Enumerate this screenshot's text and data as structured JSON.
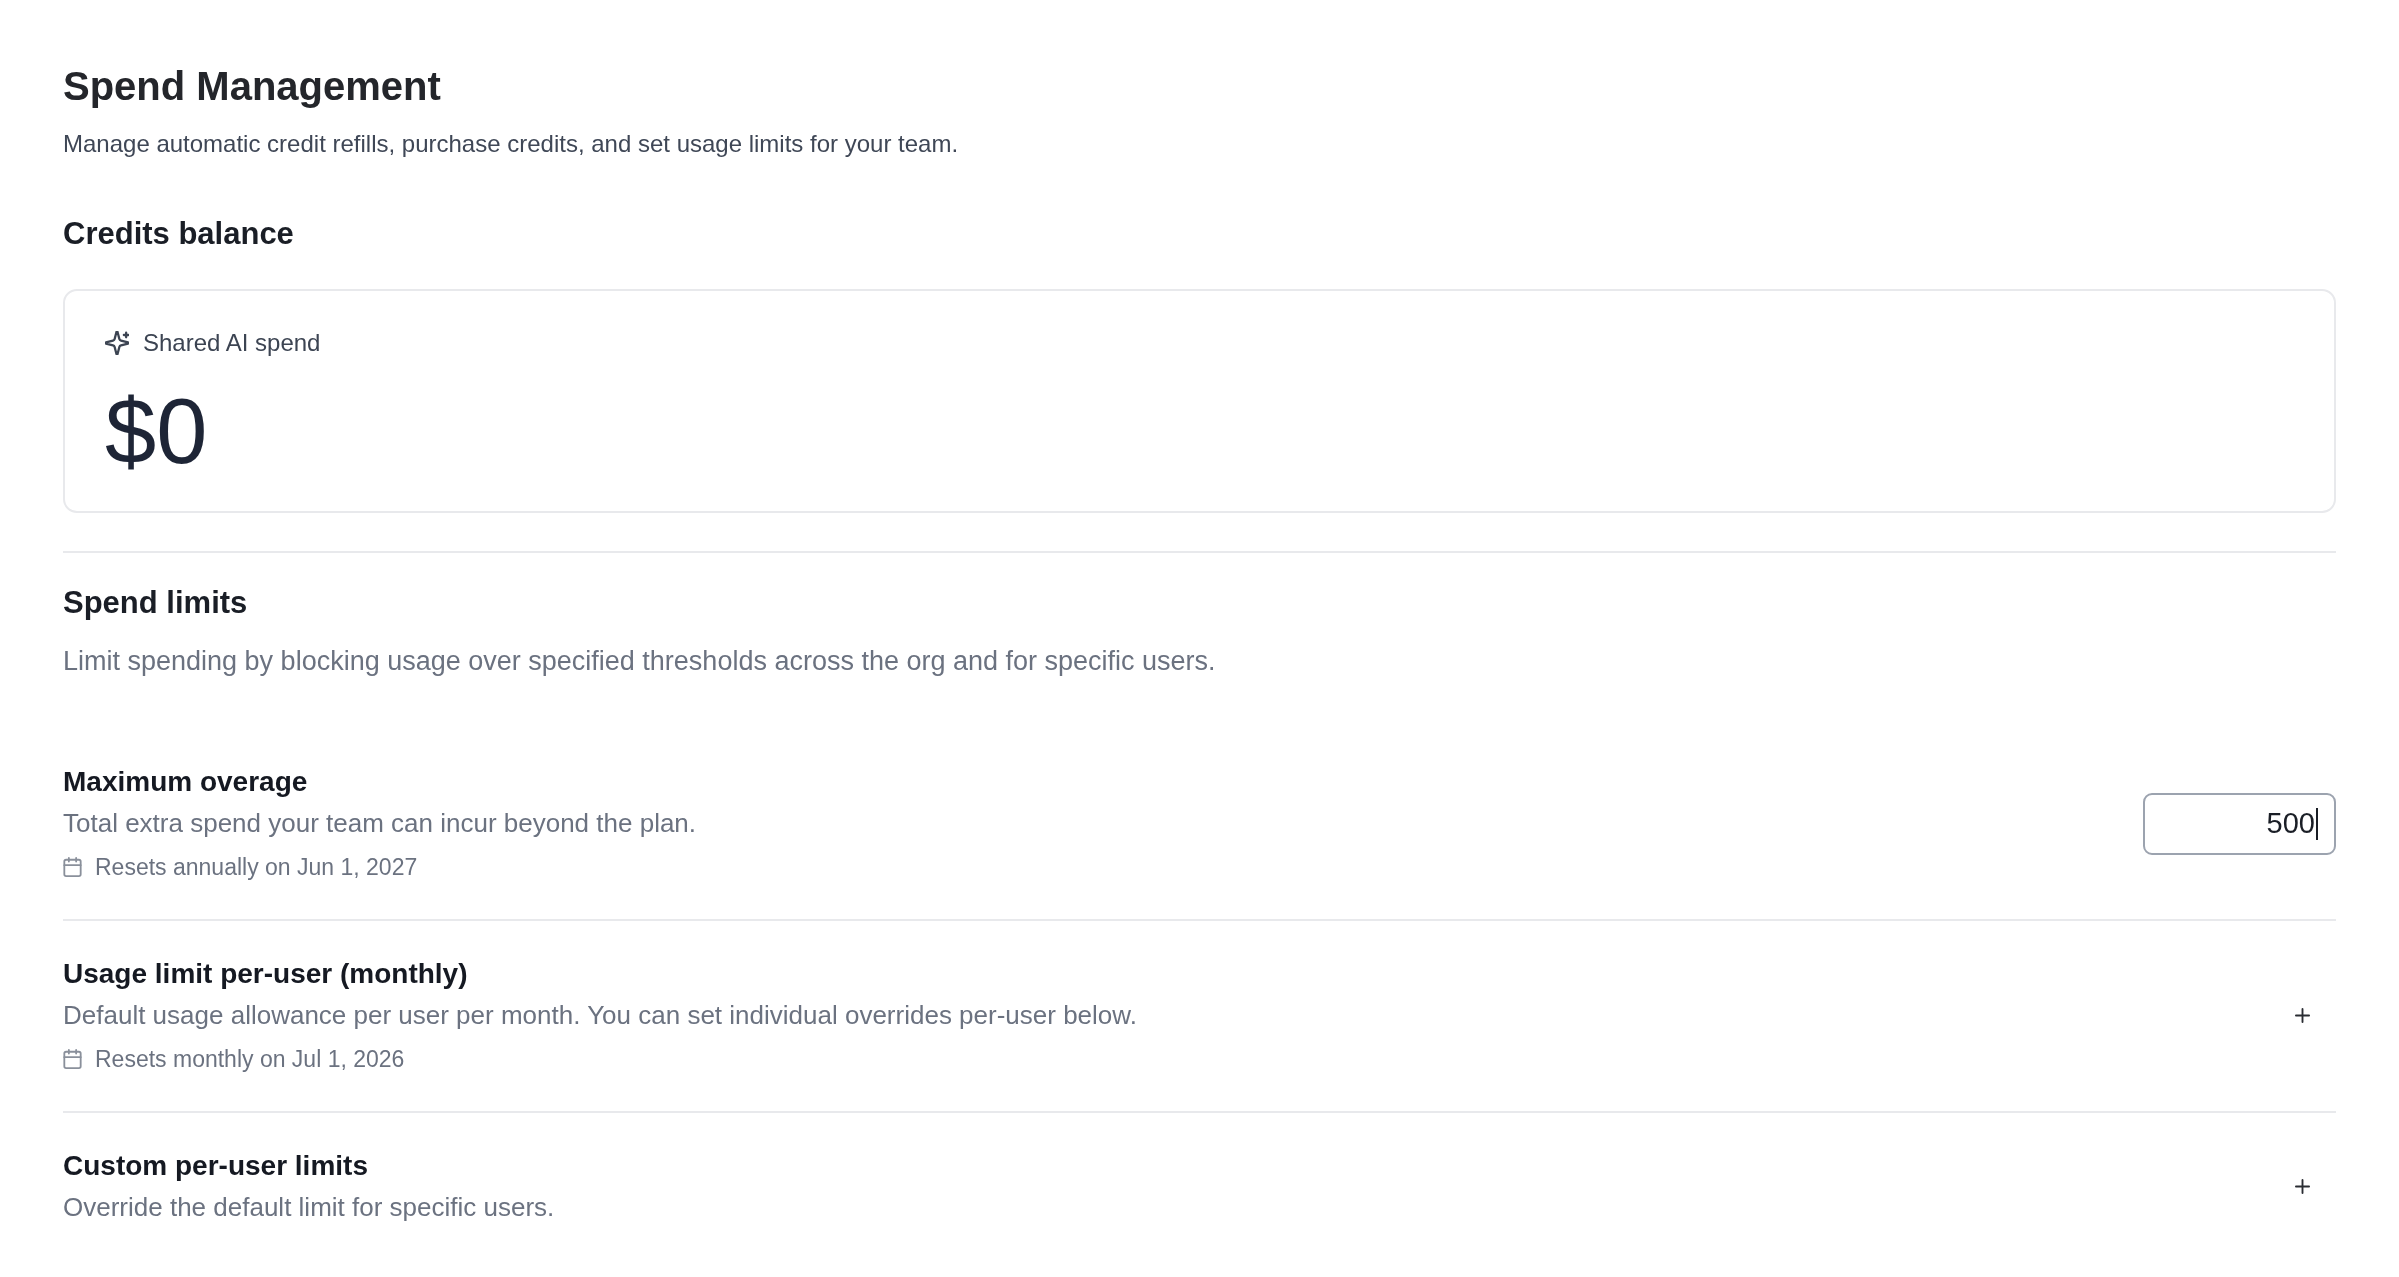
{
  "page": {
    "title": "Spend Management",
    "description": "Manage automatic credit refills, purchase credits, and set usage limits for your team."
  },
  "credits_balance": {
    "heading": "Credits balance",
    "card": {
      "label": "Shared AI spend",
      "amount": "$0"
    }
  },
  "spend_limits": {
    "heading": "Spend limits",
    "description": "Limit spending by blocking usage over specified thresholds across the org and for specific users.",
    "rows": [
      {
        "kind": "amount_field",
        "title": "Maximum overage",
        "description": "Total extra spend your team can incur beyond the plan.",
        "resets": "Resets annually on Jun 1, 2027",
        "value": "500",
        "focused": true
      },
      {
        "kind": "add",
        "title": "Usage limit per-user (monthly)",
        "description": "Default usage allowance per user per month. You can set individual overrides per-user below.",
        "resets": "Resets monthly on Jul 1, 2026"
      },
      {
        "kind": "add",
        "title": "Custom per-user limits",
        "description": "Override the default limit for specific users."
      }
    ]
  }
}
